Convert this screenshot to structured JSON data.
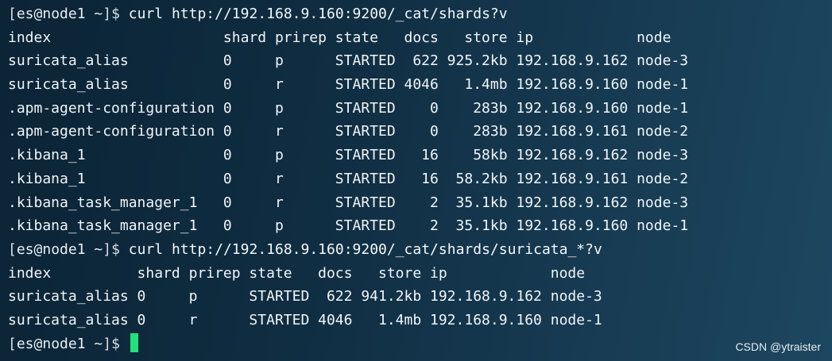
{
  "prompts": {
    "p1": {
      "open": "[",
      "user": "es",
      "at": "@",
      "host": "node1",
      "path": " ~",
      "close": "]$ ",
      "cmd": "curl http://192.168.9.160:9200/_cat/shards?v"
    },
    "p2": {
      "open": "[",
      "user": "es",
      "at": "@",
      "host": "node1",
      "path": " ~",
      "close": "]$ ",
      "cmd": "curl http://192.168.9.160:9200/_cat/shards/suricata_*?v"
    },
    "p3": {
      "open": "[",
      "user": "es",
      "at": "@",
      "host": "node1",
      "path": " ~",
      "close": "]$ ",
      "cmd": ""
    }
  },
  "output1": [
    "index                    shard prirep state   docs   store ip            node",
    "suricata_alias           0     p      STARTED  622 925.2kb 192.168.9.162 node-3",
    "suricata_alias           0     r      STARTED 4046   1.4mb 192.168.9.160 node-1",
    ".apm-agent-configuration 0     p      STARTED    0    283b 192.168.9.160 node-1",
    ".apm-agent-configuration 0     r      STARTED    0    283b 192.168.9.161 node-2",
    ".kibana_1                0     p      STARTED   16    58kb 192.168.9.162 node-3",
    ".kibana_1                0     r      STARTED   16  58.2kb 192.168.9.161 node-2",
    ".kibana_task_manager_1   0     r      STARTED    2  35.1kb 192.168.9.162 node-3",
    ".kibana_task_manager_1   0     p      STARTED    2  35.1kb 192.168.9.160 node-1"
  ],
  "output2": [
    "index          shard prirep state   docs   store ip            node",
    "suricata_alias 0     p      STARTED  622 941.2kb 192.168.9.162 node-3",
    "suricata_alias 0     r      STARTED 4046   1.4mb 192.168.9.160 node-1"
  ],
  "watermark": "CSDN @ytraister"
}
